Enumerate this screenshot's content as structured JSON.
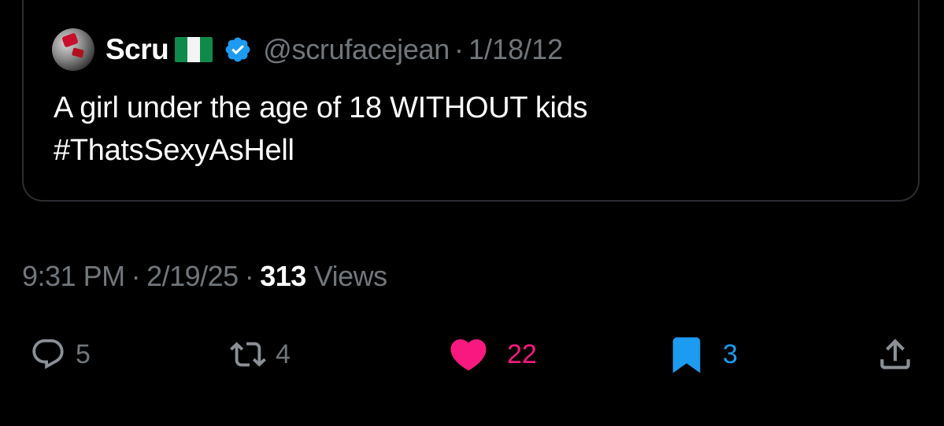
{
  "quoted_tweet": {
    "display_name": "Scru",
    "flag": "nigeria-flag",
    "verified": true,
    "handle": "@scrufacejean",
    "separator": "·",
    "date": "1/18/12",
    "text_line1": "A girl under the age of 18 WITHOUT kids",
    "text_line2": "#ThatsSexyAsHell"
  },
  "meta": {
    "time": "9:31 PM",
    "separator": "·",
    "date": "2/19/25",
    "views_count": "313",
    "views_label": "Views"
  },
  "actions": {
    "replies": "5",
    "reposts": "4",
    "likes": "22",
    "bookmarks": "3"
  },
  "colors": {
    "background": "#000000",
    "text_primary": "#ffffff",
    "text_secondary": "#71767b",
    "like_pink": "#f91880",
    "bookmark_blue": "#1d9bf0",
    "verified_blue": "#1d9bf0",
    "card_border": "#2a2e33"
  }
}
